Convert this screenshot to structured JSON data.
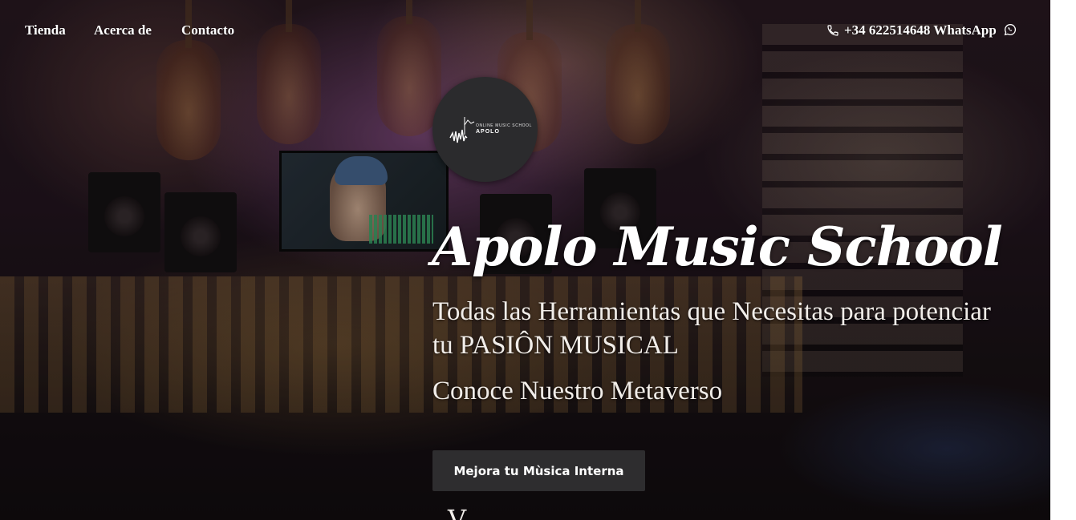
{
  "nav": {
    "items": [
      {
        "label": "Tienda"
      },
      {
        "label": "Acerca de"
      },
      {
        "label": "Contacto"
      }
    ],
    "phone_icon": "phone-icon",
    "phone_text": "+34 622514648 WhatsApp",
    "whatsapp_icon": "whatsapp-icon"
  },
  "logo": {
    "tagline": "ONLINE MUSIC SCHOOL",
    "brand": "APOLO"
  },
  "hero": {
    "title": "Apolo Music School",
    "subtitle": "Todas las Herramientas que Necesitas para potenciar tu PASIÔN MUSICAL",
    "metaverse": "Conoce Nuestro Metaverso",
    "cta_label": "Mejora tu Mùsica Interna",
    "cutoff_text": "V"
  },
  "colors": {
    "text": "#ffffff",
    "button_bg": "#2e2d2f",
    "logo_bg": "#2b2b2d"
  }
}
